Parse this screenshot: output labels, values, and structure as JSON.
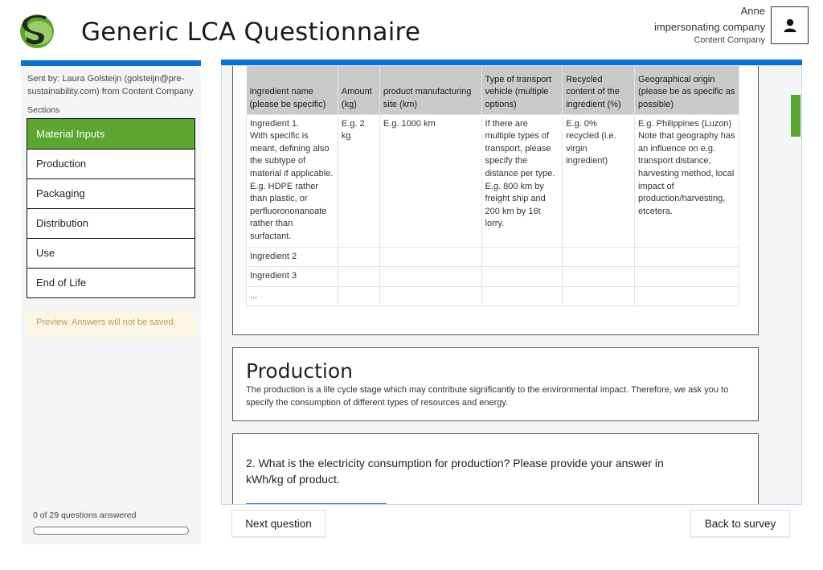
{
  "header": {
    "title": "Generic LCA Questionnaire",
    "user_name": "Anne",
    "impersonating": "impersonating company",
    "company": "Content Company"
  },
  "sidebar": {
    "sent_by": "Sent by: Laura Golsteijn (golsteijn@pre-sustainability.com) from Content Company",
    "sections_label": "Sections",
    "sections": [
      {
        "label": "Material Inputs"
      },
      {
        "label": "Production"
      },
      {
        "label": "Packaging"
      },
      {
        "label": "Distribution"
      },
      {
        "label": "Use"
      },
      {
        "label": "End of Life"
      }
    ],
    "active_section": "Material Inputs",
    "preview_note": "Preview. Answers will not be saved.",
    "progress_text": "0 of 29 questions answered",
    "progress_fraction": 0
  },
  "table": {
    "headers": [
      "Ingredient name (please be specific)",
      "Amount (kg)",
      "product manufacturing site (km)",
      "Type of transport vehicle (multiple options)",
      "Recycled content of the ingredient (%)",
      "Geographical origin (please be as specific as possible)"
    ],
    "rows": [
      [
        "Ingredient 1.\nWith specific is meant, defining also the subtype of material if applicable. E.g. HDPE rather than plastic, or perfluorononanoate rather than surfactant.",
        "E.g. 2 kg",
        "E.g. 1000 km",
        "If there are multiple types of transport, please specify the distance per type.\nE.g. 800 km by freight ship and 200 km by 16t lorry.",
        "E.g. 0% recycled (i.e. virgin ingredient)",
        "E.g. Philippines (Luzon)\nNote that geography has an influence on e.g. transport distance, harvesting method, local impact of production/harvesting, etcetera."
      ],
      [
        "Ingredient 2",
        "",
        "",
        "",
        "",
        ""
      ],
      [
        "Ingredient 3",
        "",
        "",
        "",
        "",
        ""
      ],
      [
        "...",
        "",
        "",
        "",
        "",
        ""
      ]
    ]
  },
  "production": {
    "title": "Production",
    "description": "The production is a life cycle stage which may contribute significantly to the environmental impact. Therefore, we ask you to specify the consumption of different types of resources and energy."
  },
  "question": {
    "text": "2. What is the electricity consumption for production? Please provide your answer in kWh/kg of product."
  },
  "footer": {
    "next_label": "Next question",
    "back_label": "Back to survey"
  },
  "colors": {
    "accent_blue": "#0b6fd6",
    "active_green": "#5aa62f",
    "logo_dark": "#1f2a1f"
  },
  "icons": {
    "logo": "s-logo",
    "avatar": "user-icon"
  }
}
